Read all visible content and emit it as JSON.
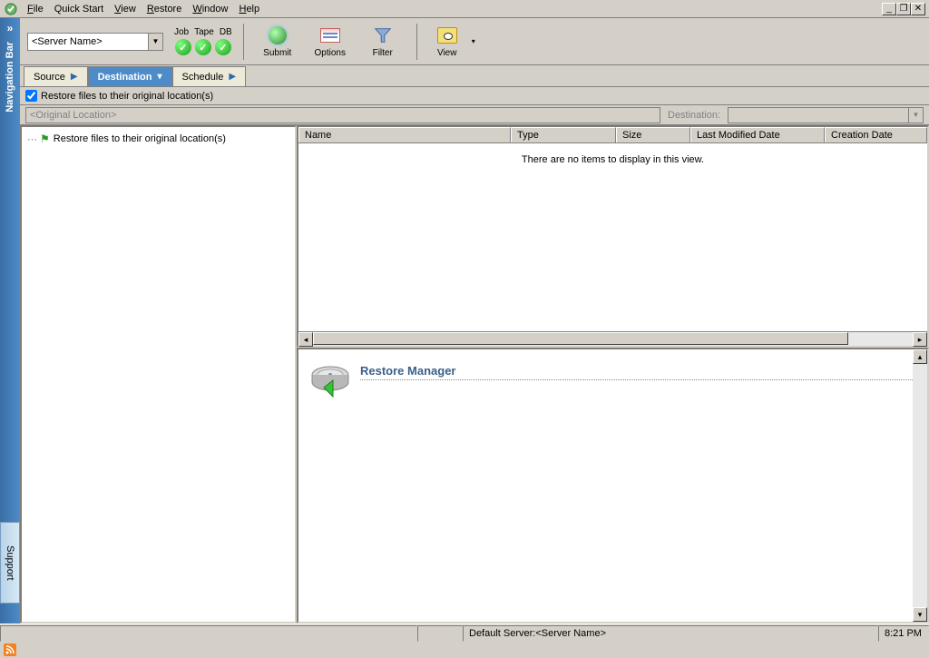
{
  "menu": {
    "file": "File",
    "quickstart": "Quick Start",
    "view": "View",
    "restore": "Restore",
    "window": "Window",
    "help": "Help"
  },
  "navbar": {
    "label": "Navigation Bar"
  },
  "support": {
    "label": "Support"
  },
  "server": {
    "placeholder": "<Server Name>"
  },
  "status": {
    "job": "Job",
    "tape": "Tape",
    "db": "DB"
  },
  "toolbar": {
    "submit": "Submit",
    "options": "Options",
    "filter": "Filter",
    "view": "View"
  },
  "tabs": {
    "source": "Source",
    "destination": "Destination",
    "schedule": "Schedule"
  },
  "checkbox": {
    "label": "Restore files to their original location(s)",
    "checked": true
  },
  "path": {
    "value": "<Original Location>",
    "dest_label": "Destination:"
  },
  "tree": {
    "root": "Restore files to their original location(s)"
  },
  "columns": {
    "name": "Name",
    "type": "Type",
    "size": "Size",
    "lastmod": "Last Modified Date",
    "creation": "Creation Date"
  },
  "list": {
    "empty": "There are no items to display in this view."
  },
  "detail": {
    "title": "Restore Manager"
  },
  "statusbar": {
    "server": "Default Server:<Server Name>",
    "time": "8:21 PM"
  }
}
